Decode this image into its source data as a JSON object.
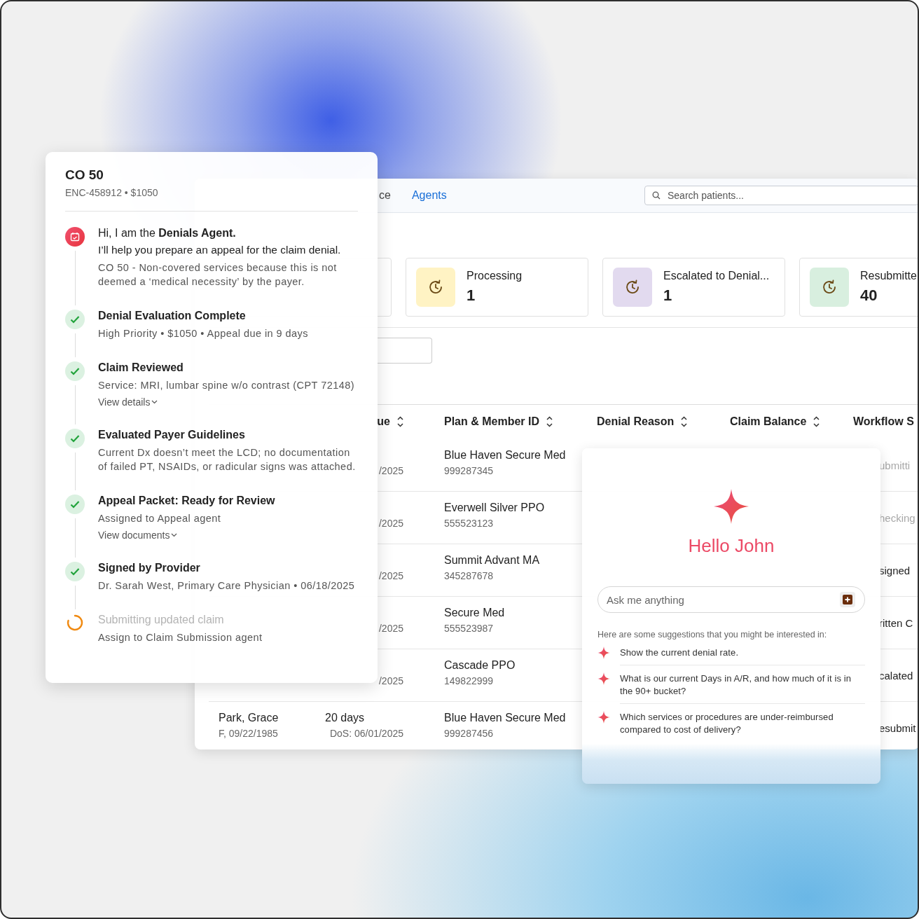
{
  "app": {
    "nav_tabs": [
      {
        "label": "ce",
        "selected": false
      },
      {
        "label": "Agents",
        "selected": true
      }
    ],
    "search": {
      "placeholder": "Search patients..."
    },
    "stat_cards": [
      {
        "label": "Processing",
        "count": "1",
        "color": "#fff3c4"
      },
      {
        "label": "Escalated to Denial...",
        "count": "1",
        "color": "#e2daef"
      },
      {
        "label": "Resubmitte",
        "count": "40",
        "color": "#d8efdf"
      }
    ],
    "table": {
      "columns": [
        "ue",
        "Plan & Member ID",
        "Denial Reason",
        "Claim Balance",
        "Workflow S"
      ],
      "rows": [
        {
          "dos": "/2025",
          "plan": "Blue Haven Secure Med",
          "member_id": "999287345",
          "workflow": "ubmitti",
          "pending": true
        },
        {
          "dos": "/2025",
          "plan": "Everwell Silver PPO",
          "member_id": "555523123",
          "workflow": "hecking",
          "pending": true
        },
        {
          "dos": "/2025",
          "plan": "Summit Advant MA",
          "member_id": "345287678",
          "workflow": "signed",
          "pending": false
        },
        {
          "dos": "/2025",
          "plan": "Secure Med",
          "member_id": "555523987",
          "workflow": "ritten C",
          "pending": false
        },
        {
          "dos": "/2025",
          "plan": "Cascade PPO",
          "member_id": "149822999",
          "workflow": "calated",
          "pending": false
        },
        {
          "patient": "Park, Grace",
          "patient_info": "F, 09/22/1985",
          "due": "20 days",
          "dos": "DoS: 06/01/2025",
          "plan": "Blue Haven Secure Med",
          "member_id": "999287456",
          "workflow": "esubmit",
          "pending": false
        }
      ]
    }
  },
  "detail_panel": {
    "title": "CO 50",
    "subtitle": "ENC-458912 • $1050",
    "steps": [
      {
        "kind": "agent",
        "title": "Hi, I am the **Denials Agent.**",
        "line": "I’ll help you prepare an appeal for the claim denial.",
        "note": "CO 50 - Non-covered services because this is not deemed a ‘medical necessity’ by the payer."
      },
      {
        "kind": "done",
        "title": "Denial Evaluation Complete",
        "note": "High Priority • $1050 • Appeal due in 9 days"
      },
      {
        "kind": "done",
        "title": "Claim Reviewed",
        "note": "Service: MRI, lumbar spine w/o contrast (CPT 72148)",
        "link": "View details"
      },
      {
        "kind": "done",
        "title": "Evaluated Payer Guidelines",
        "note": "Current Dx doesn’t meet the LCD; no documentation of failed PT, NSAIDs, or radicular signs was attached."
      },
      {
        "kind": "done",
        "title": "Appeal Packet: Ready for Review",
        "note": "Assigned to Appeal agent",
        "link": "View documents"
      },
      {
        "kind": "done",
        "title": "Signed by Provider",
        "note": "Dr. Sarah West, Primary Care Physician • 06/18/2025"
      },
      {
        "kind": "pending",
        "title": "Submitting updated claim",
        "note": "Assign to Claim Submission agent"
      }
    ]
  },
  "assistant": {
    "greeting": "Hello John",
    "input": {
      "placeholder": "Ask me anything"
    },
    "intro": "Here are some suggestions that you might be interested in:",
    "suggestions": [
      "Show the current denial rate.",
      "What is our current Days in A/R, and how much of it is in the 90+ bucket?",
      "Which services or procedures are under-reimbursed compared to cost of delivery?"
    ]
  }
}
